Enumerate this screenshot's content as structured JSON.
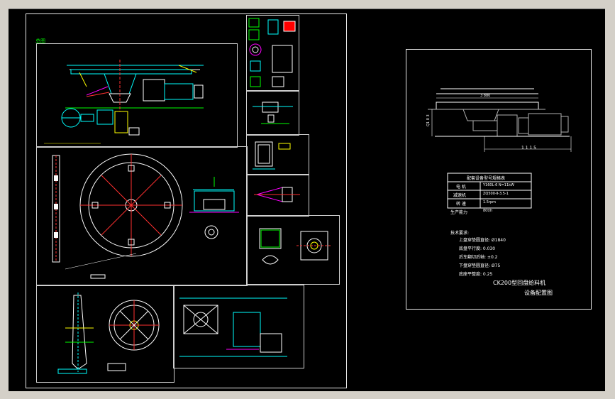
{
  "sheet_left": {
    "sheet_label": "总图"
  },
  "sheet_right": {
    "dim_top": "3 880",
    "dim_side": "Q1 0 3",
    "dim_bottom": "1 1 1 5",
    "table": {
      "title": "配套设备型号规格表",
      "rows": [
        {
          "label": "电 机",
          "value": "Y160L-6   N=11kW"
        },
        {
          "label": "减速机",
          "value": "ZQ500-Ⅱ-3.5-1"
        },
        {
          "label": "转 速",
          "value": "1.5rpm"
        },
        {
          "label": "生产能力",
          "value": "80t/h"
        }
      ]
    },
    "notes": {
      "title": "技术要求:",
      "lines": [
        "上盘穿垫圆直径: Ø1840",
        "底盘平行度: 0.030",
        "后车翻切后轴: ±0.2",
        "下盘穿垫圆直径: Ø75",
        "底座平整度: 0.25"
      ]
    },
    "title_line1": "CK200型回盘给料机",
    "title_line2": "设备配置图"
  },
  "colors": {
    "background": "#000000",
    "frame": "#e8e8e8",
    "cyan": "#00ffff",
    "white": "#ffffff",
    "green": "#00ff00",
    "magenta": "#ff00ff",
    "red": "#ff3030",
    "yellow": "#ffff00",
    "gray": "#b0b0b0"
  }
}
